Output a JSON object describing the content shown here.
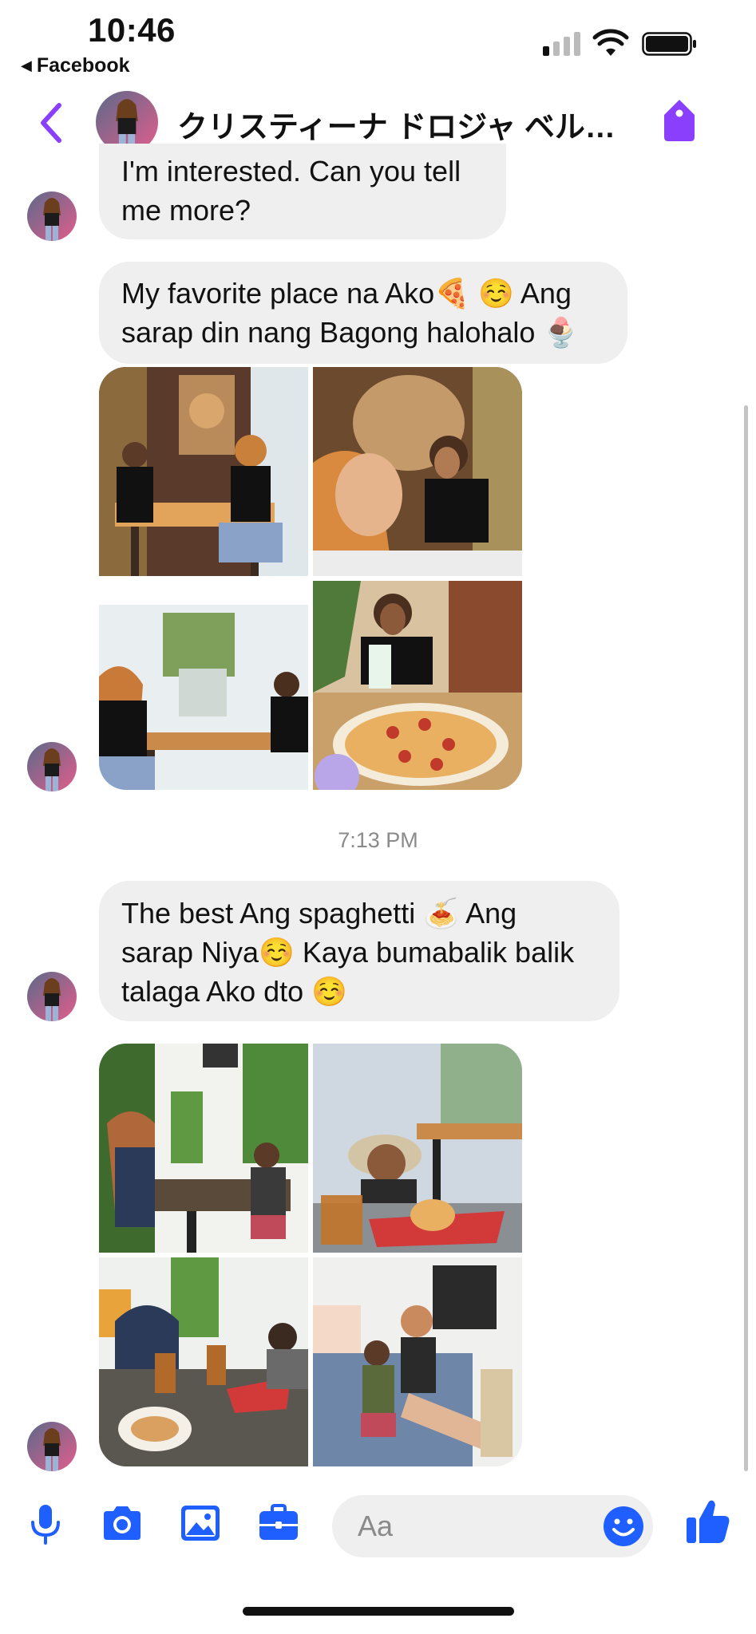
{
  "status_bar": {
    "time": "10:46",
    "back_app": "Facebook",
    "signal_icon": "cellular-signal-icon",
    "wifi_icon": "wifi-icon",
    "battery_icon": "battery-icon"
  },
  "header": {
    "title": "クリスティーナ ドロジャ ベル…",
    "back_icon": "chevron-left-icon",
    "tag_icon": "tag-icon",
    "accent_color": "#8a3ffc"
  },
  "messages": [
    {
      "type": "text",
      "lines": [
        "I'm interested. Can you tell",
        "me more?"
      ]
    },
    {
      "type": "text",
      "lines": [
        "My favorite place na Ako🍕 ☺️ Ang",
        "sarap din nang Bagong halohalo 🍨"
      ]
    },
    {
      "type": "photo_grid",
      "count": 4
    },
    {
      "type": "timestamp",
      "text": "7:13 PM"
    },
    {
      "type": "text",
      "lines": [
        "The best Ang spaghetti 🍝 Ang",
        "sarap Niya☺️ Kaya bumabalik balik",
        "talaga Ako dto ☺️"
      ]
    },
    {
      "type": "photo_grid",
      "count": 4
    }
  ],
  "composer": {
    "placeholder": "Aa",
    "icons": [
      "microphone-icon",
      "camera-icon",
      "image-icon",
      "briefcase-icon",
      "emoji-icon",
      "thumbs-up-icon"
    ],
    "icon_color": "#1f5fff"
  }
}
